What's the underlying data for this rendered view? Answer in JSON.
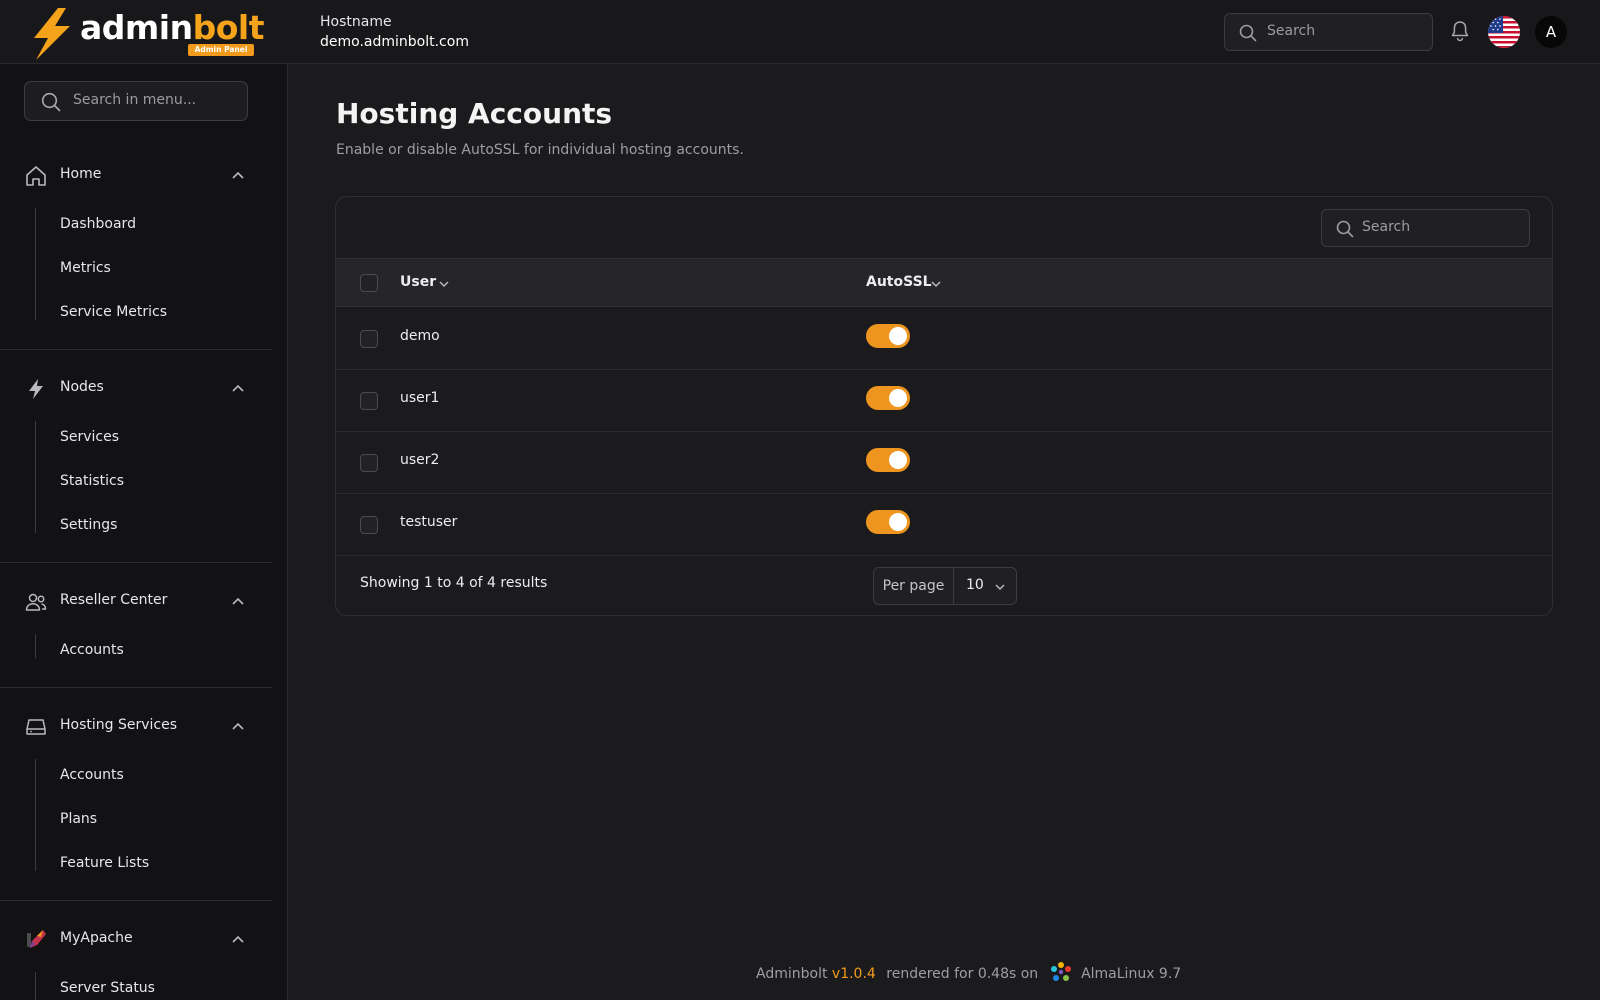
{
  "header": {
    "logo_text_main": "admin",
    "logo_text_accent": "bolt",
    "logo_badge": "Admin Panel",
    "hostname_label": "Hostname",
    "hostname_value": "demo.adminbolt.com",
    "search_placeholder": "Search",
    "avatar_letter": "A",
    "language_flag": "us-flag-icon"
  },
  "sidebar": {
    "search_placeholder": "Search in menu...",
    "groups": [
      {
        "label": "Home",
        "icon": "home-icon",
        "items": [
          "Dashboard",
          "Metrics",
          "Service Metrics"
        ]
      },
      {
        "label": "Nodes",
        "icon": "bolt-icon",
        "items": [
          "Services",
          "Statistics",
          "Settings"
        ]
      },
      {
        "label": "Reseller Center",
        "icon": "users-icon",
        "items": [
          "Accounts"
        ]
      },
      {
        "label": "Hosting Services",
        "icon": "server-icon",
        "items": [
          "Accounts",
          "Plans",
          "Feature Lists"
        ]
      },
      {
        "label": "MyApache",
        "icon": "apache-feather-icon",
        "items": [
          "Server Status"
        ]
      }
    ]
  },
  "main": {
    "title": "Hosting Accounts",
    "subtitle": "Enable or disable AutoSSL for individual hosting accounts.",
    "table": {
      "search_placeholder": "Search",
      "columns": [
        "User",
        "AutoSSL"
      ],
      "rows": [
        {
          "user": "demo",
          "autossl": true
        },
        {
          "user": "user1",
          "autossl": true
        },
        {
          "user": "user2",
          "autossl": true
        },
        {
          "user": "testuser",
          "autossl": true
        }
      ],
      "showing": "Showing 1 to 4 of 4 results",
      "per_page_label": "Per page",
      "per_page_value": "10"
    }
  },
  "footer": {
    "app": "Adminbolt",
    "version": "v1.0.4",
    "rendered": "rendered for 0.48s on",
    "os": "AlmaLinux 9.7"
  },
  "colors": {
    "accent": "#f29a1c",
    "toggle_on": "#ee9520",
    "background": "#1b1b1d",
    "sidebar": "#121214"
  }
}
